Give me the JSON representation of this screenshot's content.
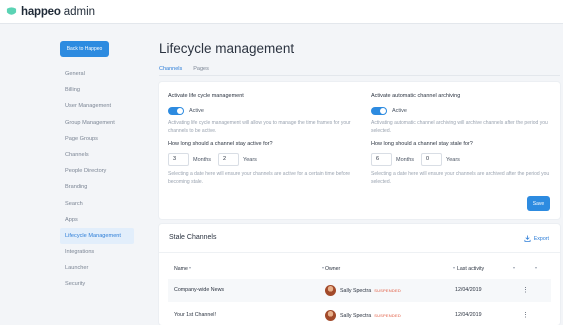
{
  "app": {
    "brand": "happeo",
    "brand_sub": "admin"
  },
  "sidebar": {
    "back_label": "Back to Happeo",
    "items": [
      {
        "label": "General"
      },
      {
        "label": "Billing"
      },
      {
        "label": "User Management"
      },
      {
        "label": "Group Management"
      },
      {
        "label": "Page Groups"
      },
      {
        "label": "Channels"
      },
      {
        "label": "People Directory"
      },
      {
        "label": "Branding"
      },
      {
        "label": "Search"
      },
      {
        "label": "Apps"
      },
      {
        "label": "Lifecycle Management",
        "active": true
      },
      {
        "label": "Integrations"
      },
      {
        "label": "Launcher"
      },
      {
        "label": "Security"
      }
    ]
  },
  "page": {
    "title": "Lifecycle management",
    "tabs": [
      {
        "label": "Channels",
        "active": true
      },
      {
        "label": "Pages"
      }
    ]
  },
  "settings": {
    "left": {
      "title": "Activate life cycle management",
      "toggle_label": "Active",
      "help": "Activating life cycle management will allow you to manage the time frames for your channels to be active.",
      "question": "How long should a channel stay active for?",
      "months_value": "3",
      "months_unit": "Months",
      "years_value": "2",
      "years_unit": "Years",
      "help2": "Selecting a date here will ensure your channels are active for a certain time before becoming stale."
    },
    "right": {
      "title": "Activate automatic channel archiving",
      "toggle_label": "Active",
      "help": "Activating automatic channel archiving will archive channels after the period you selected.",
      "question": "How long should a channel stay stale for?",
      "months_value": "6",
      "months_unit": "Months",
      "years_value": "0",
      "years_unit": "Years",
      "help2": "Selecting a date here will ensure your channels are archived after the period you selected."
    },
    "save_label": "Save"
  },
  "stale": {
    "title": "Stale Channels",
    "export_label": "Export",
    "columns": {
      "name": "Name",
      "owner": "Owner",
      "last_activity": "Last activity"
    },
    "rows": [
      {
        "name": "Company-wide News",
        "owner": "Sally Spectra",
        "status": "SUSPENDED",
        "last_activity": "12/04/2019"
      },
      {
        "name": "Your 1st Channel!",
        "owner": "Sally Spectra",
        "status": "SUSPENDED",
        "last_activity": "12/04/2019"
      }
    ]
  },
  "colors": {
    "accent": "#2d8be0",
    "suspended": "#e0563b",
    "brand_mark": "#5bd3b4"
  }
}
